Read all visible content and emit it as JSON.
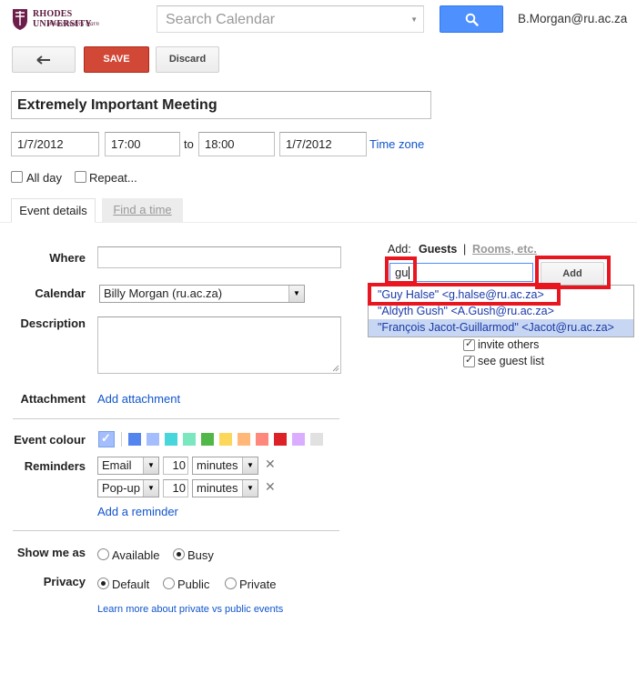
{
  "header": {
    "logo_name": "RHODES UNIVERSITY",
    "logo_tagline": "Where leaders learn",
    "search_placeholder": "Search Calendar",
    "user_email": "B.Morgan@ru.ac.za"
  },
  "toolbar": {
    "save_label": "SAVE",
    "discard_label": "Discard"
  },
  "event": {
    "title": "Extremely Important Meeting",
    "start_date": "1/7/2012",
    "start_time": "17:00",
    "to_label": "to",
    "end_time": "18:00",
    "end_date": "1/7/2012",
    "time_zone_link": "Time zone",
    "all_day_label": "All day",
    "repeat_label": "Repeat..."
  },
  "tabs": {
    "event_details": "Event details",
    "find_a_time": "Find a time"
  },
  "details": {
    "where_label": "Where",
    "where_value": "",
    "calendar_label": "Calendar",
    "calendar_value": "Billy Morgan (ru.ac.za)",
    "description_label": "Description",
    "attachment_label": "Attachment",
    "add_attachment_link": "Add attachment",
    "event_colour_label": "Event colour",
    "reminders_label": "Reminders",
    "reminders": [
      {
        "type": "Email",
        "amount": "10",
        "unit": "minutes"
      },
      {
        "type": "Pop-up",
        "amount": "10",
        "unit": "minutes"
      }
    ],
    "add_reminder_link": "Add a reminder",
    "show_me_as_label": "Show me as",
    "available_label": "Available",
    "busy_label": "Busy",
    "show_me_as_selected": "Busy",
    "privacy_label": "Privacy",
    "privacy_default": "Default",
    "privacy_public": "Public",
    "privacy_private": "Private",
    "privacy_selected": "Default",
    "learn_more_link": "Learn more about private vs public events"
  },
  "colors": {
    "default_swatch": "#a4bdfc",
    "swatches": [
      "#5484ed",
      "#a4bdfc",
      "#46d6db",
      "#7ae7bf",
      "#51b749",
      "#fbd75b",
      "#ffb878",
      "#ff887c",
      "#dc2127",
      "#dbadff",
      "#e1e1e1"
    ],
    "accent_blue": "#4d90fe",
    "save_red": "#d14836",
    "highlight_red": "#e8161f"
  },
  "guests": {
    "add_label": "Add:",
    "guests_tab": "Guests",
    "separator": "|",
    "rooms_tab": "Rooms, etc.",
    "input_value": "gu",
    "add_button": "Add",
    "suggestions": [
      "\"Guy Halse\" <g.halse@ru.ac.za>",
      "\"Aldyth Gush\" <A.Gush@ru.ac.za>",
      "\"François Jacot-Guillarmod\" <Jacot@ru.ac.za>"
    ],
    "invite_others_label": "invite others",
    "see_guest_list_label": "see guest list"
  }
}
